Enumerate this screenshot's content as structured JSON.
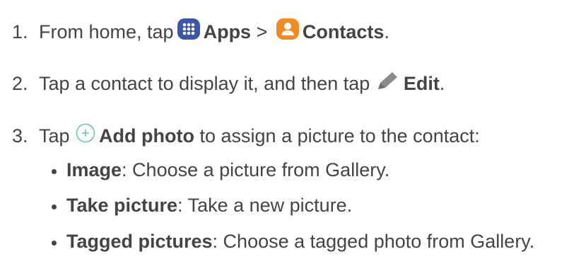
{
  "steps": [
    {
      "num": "1.",
      "parts": {
        "a": "From home, tap ",
        "b": "Apps",
        "c": " > ",
        "d": "Contacts",
        "e": "."
      }
    },
    {
      "num": "2.",
      "parts": {
        "a": "Tap a contact to display it, and then tap ",
        "b": "Edit",
        "c": "."
      }
    },
    {
      "num": "3.",
      "parts": {
        "a": "Tap ",
        "b": "Add photo",
        "c": " to assign a picture to the contact:"
      }
    }
  ],
  "bullets": [
    {
      "term": "Image",
      "desc": ": Choose a picture from Gallery."
    },
    {
      "term": "Take picture",
      "desc": ": Take a new picture."
    },
    {
      "term": "Tagged pictures",
      "desc": ": Choose a tagged photo from Gallery."
    }
  ],
  "icons": {
    "apps": "apps-grid-icon",
    "contacts": "contacts-person-icon",
    "edit": "pencil-edit-icon",
    "add_photo": "plus-circle-icon"
  },
  "colors": {
    "text": "#444444",
    "apps_icon_bg": "#3a57a8",
    "contacts_icon_bg": "#f08a24",
    "pencil": "#8a8a8a",
    "add_icon": "#5fc4b0"
  }
}
